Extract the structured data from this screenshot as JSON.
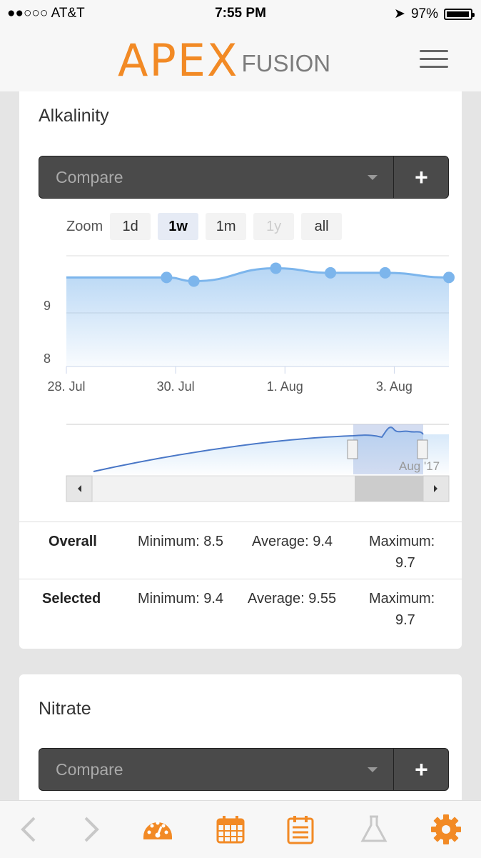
{
  "status": {
    "carrier": "●●○○○ AT&T",
    "time": "7:55 PM",
    "battery": "97%"
  },
  "header": {
    "logo_main": "APEX",
    "logo_sub": "FUSION"
  },
  "cards": [
    {
      "title": "Alkalinity",
      "compare_placeholder": "Compare",
      "compare_add": "+",
      "zoom_label": "Zoom",
      "zoom_buttons": [
        "1d",
        "1w",
        "1m",
        "1y",
        "all"
      ],
      "zoom_selected": "1w",
      "stats": {
        "overall": {
          "label": "Overall",
          "minimum": "Minimum: 8.5",
          "average": "Average: 9.4",
          "maximum_label": "Maximum:",
          "maximum_value": "9.7"
        },
        "selected": {
          "label": "Selected",
          "minimum": "Minimum: 9.4",
          "average": "Average: 9.55",
          "maximum_label": "Maximum:",
          "maximum_value": "9.7"
        }
      }
    },
    {
      "title": "Nitrate",
      "compare_placeholder": "Compare",
      "compare_add": "+"
    }
  ],
  "chart_data": {
    "type": "area",
    "x": [
      "28. Jul",
      "29. Jul",
      "30. Jul",
      "31. Jul",
      "1. Aug",
      "2. Aug",
      "3. Aug",
      "4. Aug"
    ],
    "y_ticks": [
      "9",
      "8"
    ],
    "x_ticks": [
      "28. Jul",
      "30. Jul",
      "1. Aug",
      "3. Aug"
    ],
    "points": [
      {
        "x": "28. Jul",
        "y": 9.53
      },
      {
        "x": "29. Jul 20:00",
        "y": 9.53
      },
      {
        "x": "30. Jul 08:00",
        "y": 9.45
      },
      {
        "x": "31. Jul 20:00",
        "y": 9.73
      },
      {
        "x": "1. Aug 20:00",
        "y": 9.63
      },
      {
        "x": "2. Aug 20:00",
        "y": 9.63
      },
      {
        "x": "4. Aug",
        "y": 9.53
      }
    ],
    "ylim": [
      7.6,
      10.0
    ],
    "navigator_label": "Aug '17",
    "grid": true,
    "color": "#7cb5ec"
  },
  "tabbar": {
    "icons": [
      "back-icon",
      "forward-icon",
      "dashboard-icon",
      "calendar-icon",
      "log-icon",
      "flask-icon",
      "gear-icon"
    ],
    "accent": "#f28a25",
    "muted": "#c8c8c8"
  }
}
